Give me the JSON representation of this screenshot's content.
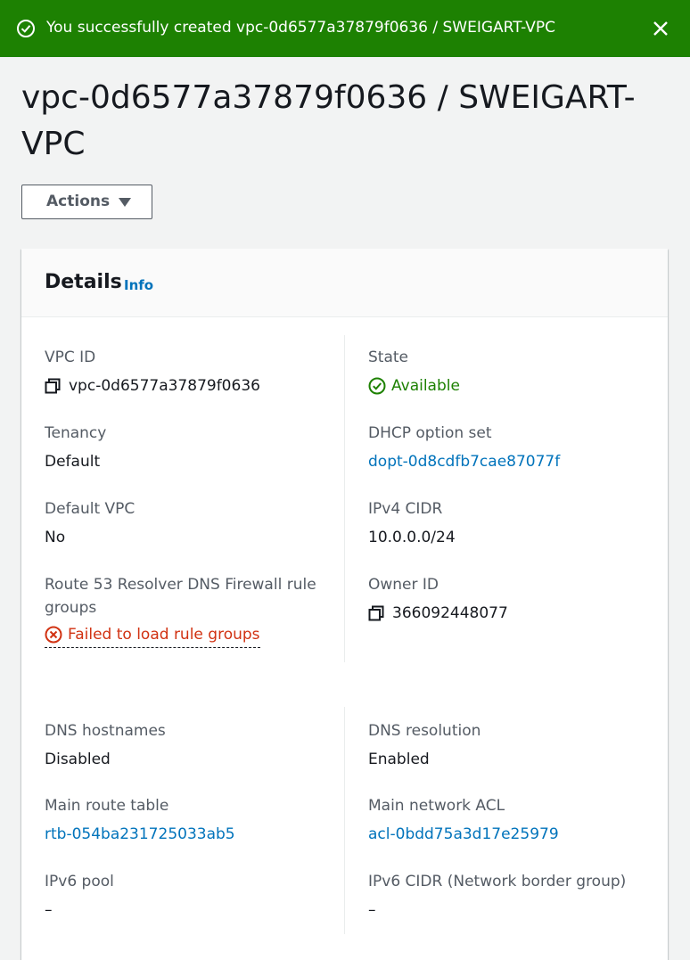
{
  "flash": {
    "message": "You successfully created vpc-0d6577a37879f0636 / SWEIGART-VPC",
    "icon": "check-circle-icon",
    "close_icon": "close-icon",
    "color": "#1d8102"
  },
  "page": {
    "title": "vpc-0d6577a37879f0636 / SWEIGART-VPC",
    "actions_label": "Actions"
  },
  "details": {
    "heading": "Details",
    "info_label": "Info",
    "left": [
      {
        "key": "VPC ID",
        "value": "vpc-0d6577a37879f0636",
        "style": "copy"
      },
      {
        "key": "Tenancy",
        "value": "Default",
        "style": "plain"
      },
      {
        "key": "Default VPC",
        "value": "No",
        "style": "plain"
      },
      {
        "key": "Route 53 Resolver DNS Firewall rule groups",
        "value": "Failed to load rule groups",
        "style": "error"
      },
      {
        "key": "DNS hostnames",
        "value": "Disabled",
        "style": "plain"
      },
      {
        "key": "Main route table",
        "value": "rtb-054ba231725033ab5",
        "style": "link"
      },
      {
        "key": "IPv6 pool",
        "value": "–",
        "style": "plain"
      }
    ],
    "right": [
      {
        "key": "State",
        "value": "Available",
        "style": "status-ok"
      },
      {
        "key": "DHCP option set",
        "value": "dopt-0d8cdfb7cae87077f",
        "style": "link"
      },
      {
        "key": "IPv4 CIDR",
        "value": "10.0.0.0/24",
        "style": "plain"
      },
      {
        "key": "Owner ID",
        "value": "366092448077",
        "style": "copy"
      },
      {
        "key": "DNS resolution",
        "value": "Enabled",
        "style": "plain"
      },
      {
        "key": "Main network ACL",
        "value": "acl-0bdd75a3d17e25979",
        "style": "link"
      },
      {
        "key": "IPv6 CIDR (Network border group)",
        "value": "–",
        "style": "plain"
      }
    ]
  },
  "colors": {
    "link": "#0073bb",
    "success": "#1d8102",
    "error": "#d13212",
    "label": "#545b64"
  }
}
